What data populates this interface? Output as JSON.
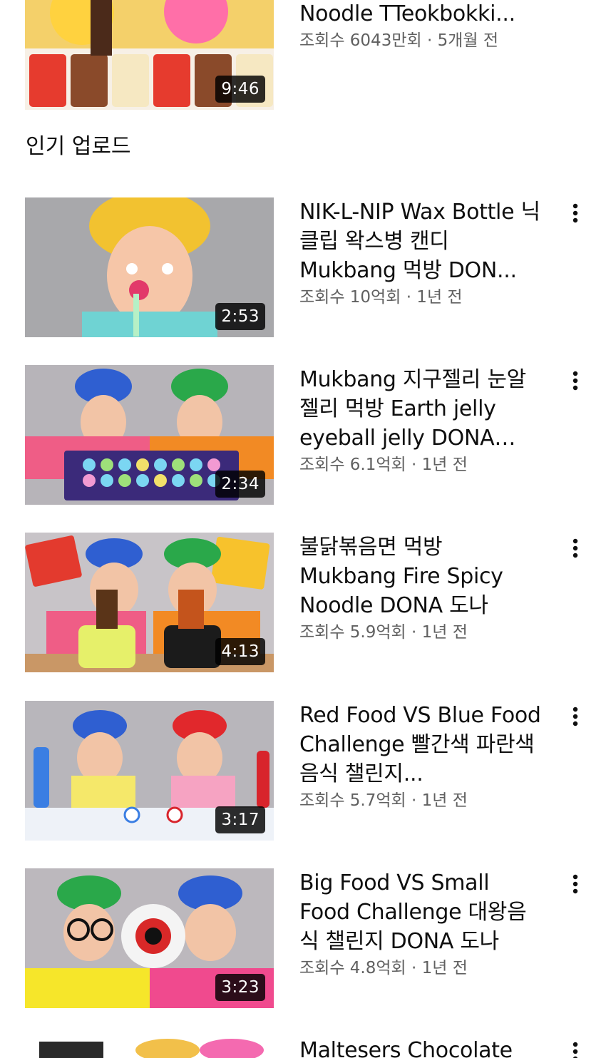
{
  "videos_top": {
    "title": "이 짜장면 먹방 Black Noodle TTeokbokki...",
    "meta": "조회수 6043만회 · 5개월 전",
    "duration": "9:46"
  },
  "section": {
    "title": "인기 업로드"
  },
  "videos": [
    {
      "title": "NIK-L-NIP Wax Bottle 닉클립 왁스병 캔디 Mukbang 먹방 DON...",
      "meta": "조회수 10억회 · 1년 전",
      "duration": "2:53"
    },
    {
      "title": "Mukbang 지구젤리 눈알젤리 먹방 Earth jelly eyeball jelly DONA…",
      "meta": "조회수 6.1억회 · 1년 전",
      "duration": "2:34"
    },
    {
      "title": "불닭볶음면 먹방 Mukbang Fire Spicy Noodle DONA 도나",
      "meta": "조회수 5.9억회 · 1년 전",
      "duration": "4:13"
    },
    {
      "title": "Red Food VS Blue Food Challenge 빨간색 파란색 음식 챌린지...",
      "meta": "조회수 5.7억회 · 1년 전",
      "duration": "3:17"
    },
    {
      "title": "Big Food VS Small Food Challenge 대왕음식 챌린지 DONA 도나",
      "meta": "조회수 4.8억회 · 1년 전",
      "duration": "3:23"
    },
    {
      "title": "Maltesers Chocolate"
    }
  ],
  "icons": {
    "menu": "more-vert-icon"
  },
  "colors": {
    "title_text": "#0f0f0f",
    "meta_text": "#606060",
    "duration_bg": "#000000cc"
  }
}
